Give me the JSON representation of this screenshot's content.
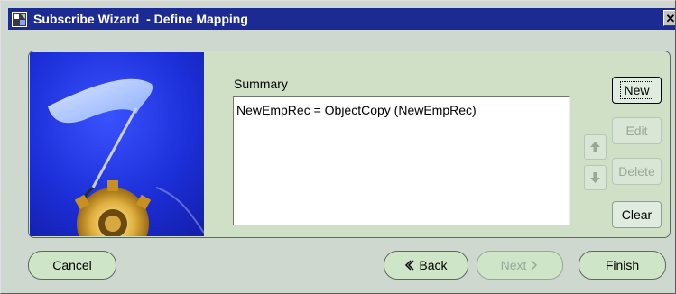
{
  "window": {
    "title": "Subscribe Wizard  - Define Mapping",
    "close_glyph": "✕"
  },
  "summary": {
    "label": "Summary",
    "items": [
      "NewEmpRec = ObjectCopy (NewEmpRec)"
    ]
  },
  "side_buttons": {
    "new": "New",
    "edit": "Edit",
    "delete": "Delete",
    "clear": "Clear"
  },
  "footer": {
    "cancel": "Cancel",
    "back_mnemonic": "B",
    "back_rest": "ack",
    "next_mnemonic": "N",
    "next_rest": "ext",
    "finish_mnemonic": "F",
    "finish_rest": "inish"
  },
  "icons": {
    "window": "wizard-window-icon",
    "move_up": "up-arrow-icon",
    "move_down": "down-arrow-icon",
    "back": "back-chevron-icon",
    "next": "next-chevron-icon"
  },
  "colors": {
    "titlebar": "#1c2a94",
    "panel": "#cfe0c6",
    "window": "#cfd8cf",
    "image_background": "#1e2bd2",
    "disabled_text": "#98a898"
  }
}
